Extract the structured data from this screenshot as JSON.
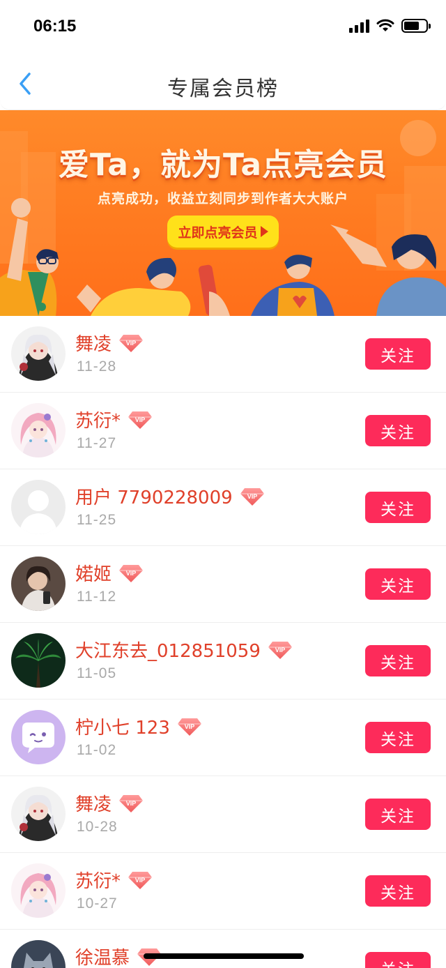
{
  "status_bar": {
    "time": "06:15",
    "battery_level": 0.7
  },
  "nav": {
    "title": "专属会员榜"
  },
  "banner": {
    "title": "爱Ta，就为Ta点亮会员",
    "subtitle": "点亮成功，收益立刻同步到作者大大账户",
    "cta_label": "立即点亮会员",
    "colors": {
      "background": "#ff7a20",
      "cta": "#ffe11a"
    }
  },
  "members": [
    {
      "name": "舞凌",
      "date": "11-28",
      "badge": "VIP",
      "avatar": "anime-girl-white-hair",
      "follow_label": "关注"
    },
    {
      "name": "苏衍*",
      "date": "11-27",
      "badge": "VIP",
      "avatar": "anime-girl-pink-hair",
      "follow_label": "关注"
    },
    {
      "name": "用户 7790228009",
      "date": "11-25",
      "badge": "VIP",
      "avatar": "default-user",
      "follow_label": "关注"
    },
    {
      "name": "婼姬",
      "date": "11-12",
      "badge": "VIP",
      "avatar": "photo-portrait",
      "follow_label": "关注"
    },
    {
      "name": "大江东去_012851059",
      "date": "11-05",
      "badge": "VIP",
      "avatar": "palm-tree-night",
      "follow_label": "关注"
    },
    {
      "name": "柠小七 123",
      "date": "11-02",
      "badge": "VIP",
      "avatar": "chat-bubble-purple",
      "follow_label": "关注"
    },
    {
      "name": "舞凌",
      "date": "10-28",
      "badge": "VIP",
      "avatar": "anime-girl-white-hair",
      "follow_label": "关注"
    },
    {
      "name": "苏衍*",
      "date": "10-27",
      "badge": "VIP",
      "avatar": "anime-girl-pink-hair",
      "follow_label": "关注"
    },
    {
      "name": "徐温慕",
      "date": "",
      "badge": "VIP",
      "avatar": "cat-photo",
      "follow_label": "关注"
    }
  ],
  "colors": {
    "name": "#e0402a",
    "date": "#a9a9a9",
    "follow": "#fd2b5a",
    "back": "#3a9ff5"
  }
}
